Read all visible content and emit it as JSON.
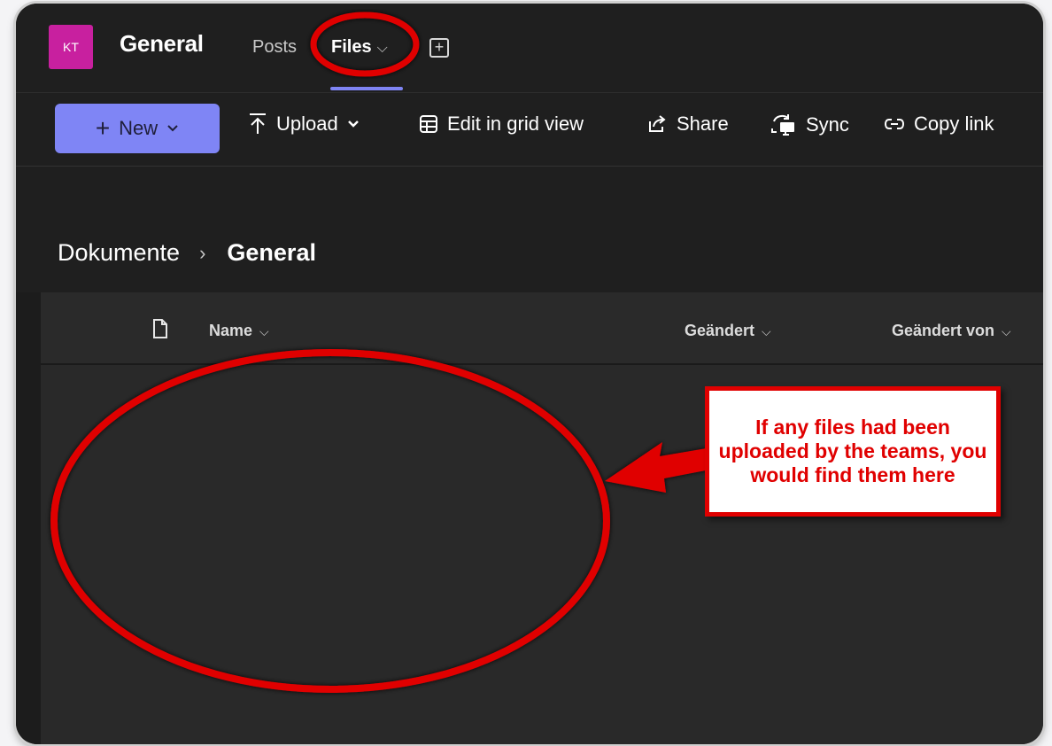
{
  "header": {
    "avatar_initials": "KT",
    "channel_title": "General",
    "tabs": [
      {
        "label": "Posts"
      },
      {
        "label": "Files"
      }
    ]
  },
  "toolbar": {
    "new_label": "New",
    "upload_label": "Upload",
    "grid_label": "Edit in grid view",
    "share_label": "Share",
    "sync_label": "Sync",
    "copy_label": "Copy link"
  },
  "breadcrumb": {
    "root": "Dokumente",
    "current": "General"
  },
  "list": {
    "columns": [
      "Name",
      "Geändert",
      "Geändert von"
    ]
  },
  "annotation": {
    "callout_text": "If any files had been uploaded by the teams, you would find them here"
  },
  "colors": {
    "accent": "#7f85f5",
    "avatar": "#c8209f",
    "annotation_red": "#e00000"
  }
}
